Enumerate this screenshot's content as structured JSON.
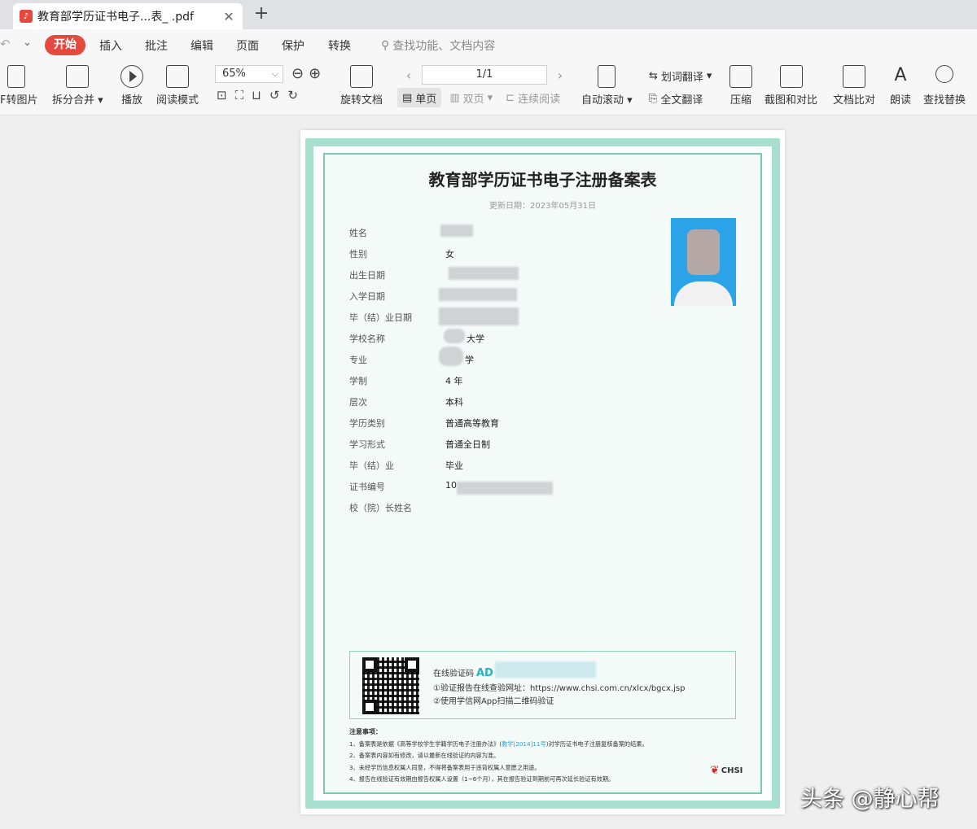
{
  "tab": {
    "title": "教育部学历证书电子...表_       .pdf",
    "close": "✕",
    "new_tab": "+"
  },
  "menu": {
    "left_icons": [
      "↶",
      "⌄"
    ],
    "start": "开始",
    "items": [
      "插入",
      "批注",
      "编辑",
      "页面",
      "保护",
      "转换"
    ],
    "search_placeholder": "查找功能、文档内容"
  },
  "toolbar": {
    "pdf_to_image": "F转图片",
    "split_merge": "拆分合并",
    "play": "播放",
    "read_mode": "阅读模式",
    "zoom_value": "65%",
    "rotate_doc": "旋转文档",
    "page_display": "1/1",
    "single_page": "单页",
    "double_page": "双页",
    "continuous_read": "连续阅读",
    "auto_scroll": "自动滚动",
    "word_translate": "划词翻译",
    "full_translate": "全文翻译",
    "compress": "压缩",
    "screenshot_compare": "截图和对比",
    "doc_compare": "文档比对",
    "read_aloud": "朗读",
    "find_replace": "查找替换"
  },
  "document": {
    "title": "教育部学历证书电子注册备案表",
    "update_date": "更新日期：2023年05月31日",
    "fields": [
      {
        "label": "姓名",
        "value": ""
      },
      {
        "label": "性别",
        "value": "女"
      },
      {
        "label": "出生日期",
        "value": ""
      },
      {
        "label": "入学日期",
        "value": ""
      },
      {
        "label": "毕（结）业日期",
        "value": ""
      },
      {
        "label": "学校名称",
        "value": "大学"
      },
      {
        "label": "专业",
        "value": "学"
      },
      {
        "label": "学制",
        "value": "4 年"
      },
      {
        "label": "层次",
        "value": "本科"
      },
      {
        "label": "学历类别",
        "value": "普通高等教育"
      },
      {
        "label": "学习形式",
        "value": "普通全日制"
      },
      {
        "label": "毕（结）业",
        "value": "毕业"
      },
      {
        "label": "证书编号",
        "value": "10"
      },
      {
        "label": "校（院）长姓名",
        "value": ""
      }
    ],
    "verify": {
      "code_label": "在线验证码",
      "code_prefix": "AD",
      "line1": "①验证报告在线查验网址：https://www.chsi.com.cn/xlcx/bgcx.jsp",
      "line2": "②使用学信网App扫描二维码验证"
    },
    "notes": {
      "title": "注意事项：",
      "n1_pre": "1、备案表是依据《高等学校学生学籍学历电子注册办法》(",
      "n1_link": "教学[2014]11号",
      "n1_post": ")对学历证书电子注册复核备案的结果。",
      "n2": "2、备案表内容如有修改，请以最新在线验证的内容为准。",
      "n3": "3、未经学历信息权属人同意，不得将备案表用于违背权属人意愿之用途。",
      "n4": "4、报告在线验证有效期由报告权属人设置（1~6个月），其在报告验证到期前可再次延长验证有效期。"
    },
    "logo_text": "CHSI"
  },
  "watermark": "头条 @静心帮"
}
